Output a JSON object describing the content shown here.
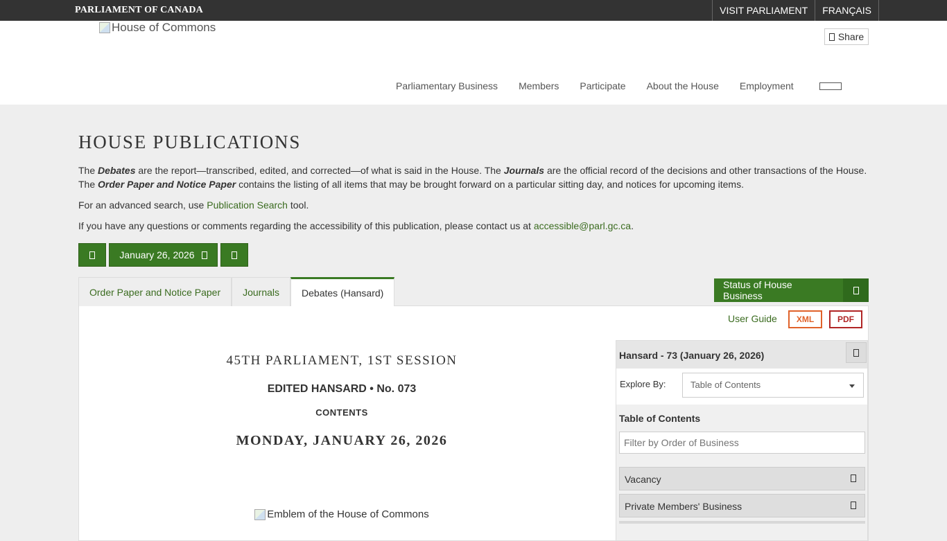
{
  "topbar": {
    "brand": "PARLIAMENT OF CANADA",
    "links": [
      "VISIT PARLIAMENT",
      "FRANÇAIS"
    ]
  },
  "header": {
    "logo_alt": "House of Commons",
    "share_label": "Share",
    "nav": [
      "Parliamentary Business",
      "Members",
      "Participate",
      "About the House",
      "Employment"
    ]
  },
  "page": {
    "title": "HOUSE PUBLICATIONS",
    "intro": {
      "p1_a": "The ",
      "p1_debates": "Debates",
      "p1_b": " are the report—transcribed, edited, and corrected—of what is said in the House. The ",
      "p1_journals": "Journals",
      "p1_c": " are the official record of the decisions and other transactions of the House. The ",
      "p1_order": "Order Paper and Notice Paper",
      "p1_d": " contains the listing of all items that may be brought forward on a particular sitting day, and notices for upcoming items.",
      "p2_a": "For an advanced search, use ",
      "p2_link": "Publication Search",
      "p2_b": " tool.",
      "p3_a": "If you have any questions or comments regarding the accessibility of this publication, please contact us at ",
      "p3_link": "accessible@parl.gc.ca",
      "p3_b": "."
    }
  },
  "datebar": {
    "date": "January 26, 2026"
  },
  "tabs": [
    "Order Paper and Notice Paper",
    "Journals",
    "Debates (Hansard)"
  ],
  "status_button": "Status of House Business",
  "tools": {
    "user_guide": "User Guide",
    "xml": "XML",
    "pdf": "PDF"
  },
  "document": {
    "parliament": "45TH PARLIAMENT, 1ST SESSION",
    "hansard": "EDITED HANSARD • No. 073",
    "contents": "CONTENTS",
    "date": "MONDAY, JANUARY 26, 2026",
    "emblem_alt": "Emblem of the House of Commons"
  },
  "sidebar": {
    "header": "Hansard - 73 (January 26, 2026)",
    "explore_label": "Explore By:",
    "explore_value": "Table of Contents",
    "toc_title": "Table of Contents",
    "filter_placeholder": "Filter by Order of Business",
    "items": [
      "Vacancy",
      "Private Members' Business"
    ]
  },
  "colors": {
    "accent": "#3a7a23",
    "topbar": "#333333",
    "xml": "#e0622a",
    "pdf": "#b02525"
  }
}
